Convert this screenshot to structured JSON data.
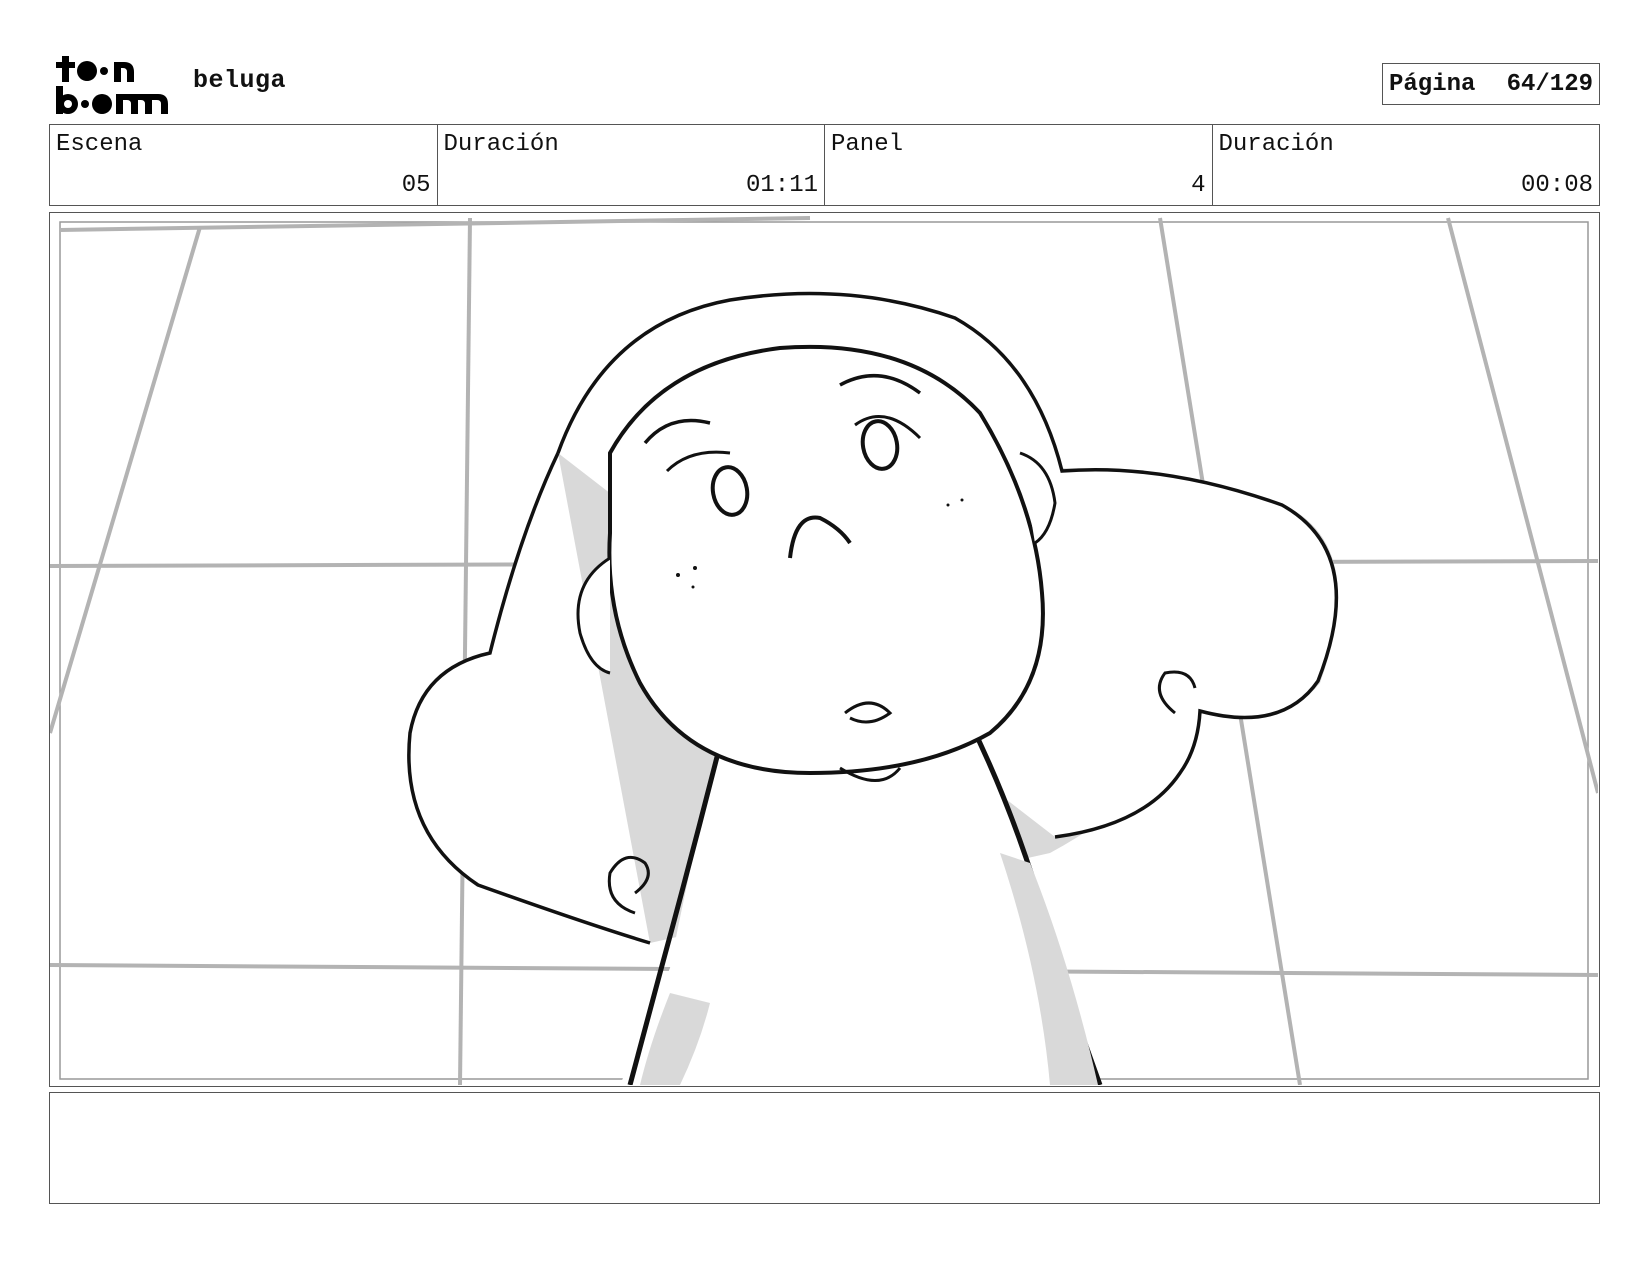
{
  "header": {
    "logo_text": "toon boom",
    "project_name": "beluga",
    "page_label": "Página",
    "page_value": "64/129"
  },
  "info": [
    {
      "label": "Escena",
      "value": "05"
    },
    {
      "label": "Duración",
      "value": "01:11"
    },
    {
      "label": "Panel",
      "value": "4"
    },
    {
      "label": "Duración",
      "value": "00:08"
    }
  ],
  "notes": ""
}
